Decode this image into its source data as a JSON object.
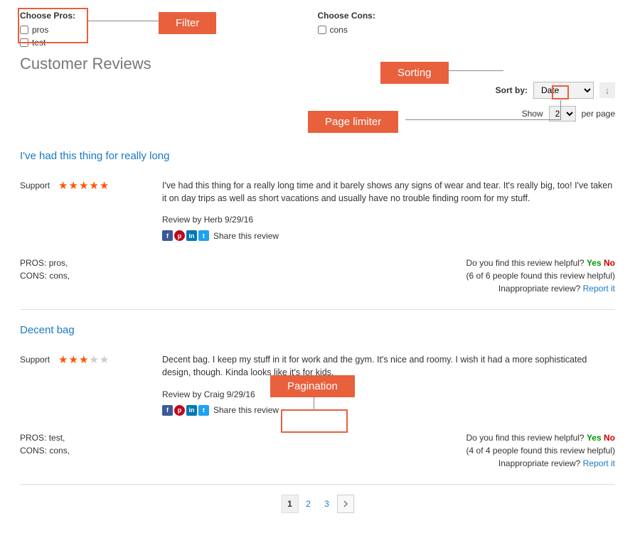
{
  "filters": {
    "pros_label": "Choose Pros:",
    "cons_label": "Choose Cons:",
    "pros_options": [
      "pros",
      "test"
    ],
    "cons_options": [
      "cons"
    ]
  },
  "section_title": "Customer Reviews",
  "toolbar": {
    "sort_label": "Sort by:",
    "sort_value": "Date",
    "show_label": "Show",
    "per_page_label": "per page",
    "limit_value": "2"
  },
  "reviews": [
    {
      "title": "I've had this thing for really long",
      "rating_label": "Support",
      "rating": 5,
      "body": "I've had this thing for a really long time and it barely shows any signs of wear and tear. It's really big, too! I've taken it on day trips as well as short vacations and usually have no trouble finding room for my stuff.",
      "author": "Herb",
      "date": "9/29/16",
      "byline": "Review by Herb 9/29/16",
      "share_label": "Share this review",
      "pros": "pros,",
      "cons": "cons,",
      "helpful_q": "Do you find this review helpful?",
      "yes": "Yes",
      "no": "No",
      "helpful_stats": "(6 of 6 people found this review helpful)",
      "report_q": "Inappropriate review?",
      "report": "Report it"
    },
    {
      "title": "Decent bag",
      "rating_label": "Support",
      "rating": 3,
      "body": "Decent bag. I keep my stuff in it for work and the gym. It's nice and roomy. I wish it had a more sophisticated design, though. Kinda looks like it's for kids.",
      "author": "Craig",
      "date": "9/29/16",
      "byline": "Review by Craig 9/29/16",
      "share_label": "Share this review",
      "pros": "test,",
      "cons": "cons,",
      "helpful_q": "Do you find this review helpful?",
      "yes": "Yes",
      "no": "No",
      "helpful_stats": "(4 of 4 people found this review helpful)",
      "report_q": "Inappropriate review?",
      "report": "Report it"
    }
  ],
  "pagination": {
    "current": "1",
    "pages": [
      "1",
      "2",
      "3"
    ]
  },
  "callouts": {
    "filter": "Filter",
    "sorting": "Sorting",
    "page_limiter": "Page limiter",
    "pagination": "Pagination"
  },
  "labels": {
    "pros_prefix": "PROS: ",
    "cons_prefix": "CONS: "
  }
}
